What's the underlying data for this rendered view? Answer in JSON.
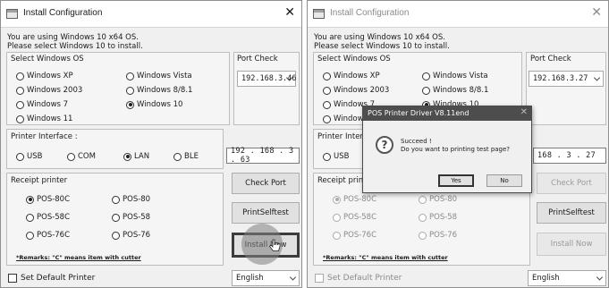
{
  "window": {
    "title": "Install Configuration",
    "close_glyph": "✕",
    "info_line1": "You are using Windows 10 x64 OS.",
    "info_line2": "Please select Windows 10 to install."
  },
  "os_group": {
    "label": "Select Windows OS",
    "options": [
      "Windows XP",
      "Windows Vista",
      "Windows 2003",
      "Windows 8/8.1",
      "Windows 7",
      "Windows 10",
      "Windows 11"
    ],
    "selected": "Windows 10"
  },
  "port_check": {
    "label": "Port Check",
    "left_value": "192.168.3.46",
    "right_value": "192.168.3.27"
  },
  "printer_interface": {
    "label": "Printer Interface :",
    "options": [
      "USB",
      "COM",
      "LAN",
      "BLE"
    ],
    "selected": "LAN",
    "left_ip": "192 . 168 . 3  . 63",
    "right_ip": "168 . 3  . 27"
  },
  "receipt": {
    "label": "Receipt printer",
    "options": [
      "POS-80C",
      "POS-80",
      "POS-58C",
      "POS-58",
      "POS-76C",
      "POS-76"
    ],
    "selected": "POS-80C"
  },
  "buttons": {
    "check_port": "Check Port",
    "print_selftest": "PrintSelftest",
    "install_now": "Install Now"
  },
  "remarks": "*Remarks: \"C\" means item with cutter",
  "default_printer_label": "Set Default Printer",
  "language": "English",
  "dialog": {
    "title": "POS Printer Driver V8.11end",
    "close_glyph": "✕",
    "message_line1": "Succeed !",
    "message_line2": "Do you want to printing test page?",
    "yes": "Yes",
    "no": "No",
    "icon": "question-icon"
  },
  "colors": {
    "window_bg": "#f0f0f0",
    "dialog_title_bg": "#4d4d4d"
  }
}
